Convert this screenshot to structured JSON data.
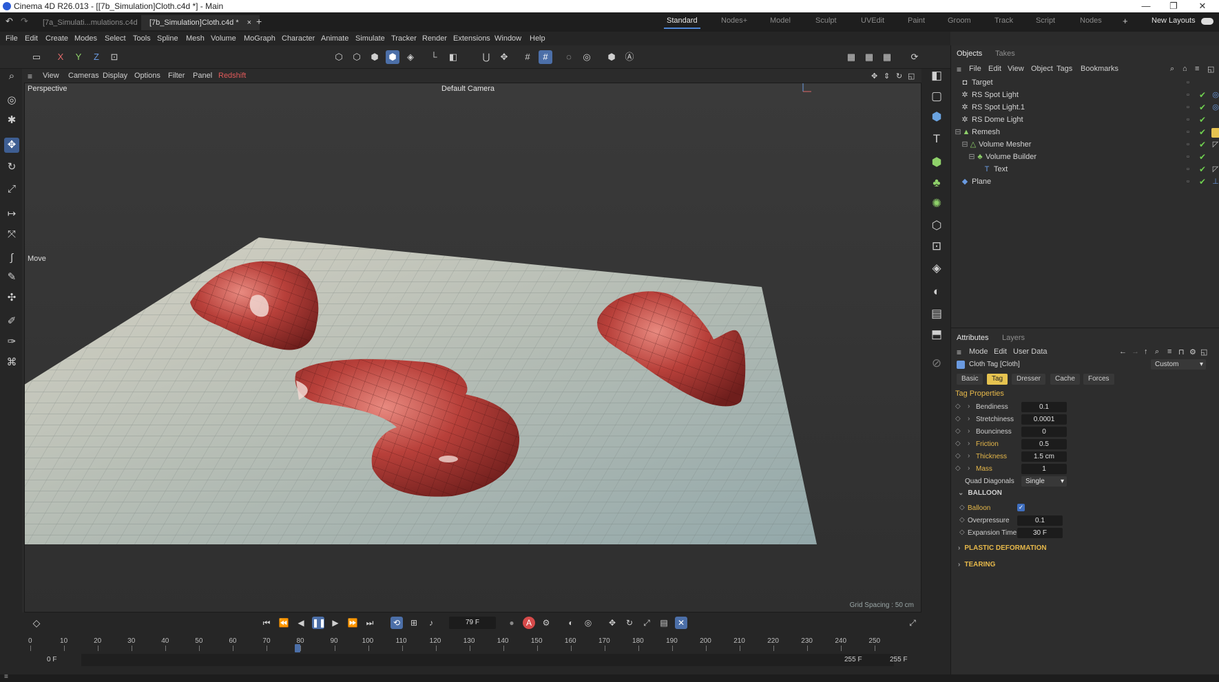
{
  "window": {
    "title": "Cinema 4D R26.013 - [[7b_Simulation]Cloth.c4d *] - Main",
    "controls": [
      "—",
      "❐",
      "✕"
    ]
  },
  "tabs": [
    {
      "label": "[7a_Simulati...mulations.c4d"
    },
    {
      "label": "[7b_Simulation]Cloth.c4d *"
    }
  ],
  "layouts": [
    "Standard",
    "Nodes+",
    "Model",
    "Sculpt",
    "UVEdit",
    "Paint",
    "Groom",
    "Track",
    "Script",
    "Nodes"
  ],
  "new_layouts": "New Layouts",
  "menus": [
    "File",
    "Edit",
    "Create",
    "Modes",
    "Select",
    "Tools",
    "Spline",
    "Mesh",
    "Volume",
    "MoGraph",
    "Character",
    "Animate",
    "Simulate",
    "Tracker",
    "Render",
    "Extensions",
    "Window",
    "Help"
  ],
  "axis_toggles": [
    "X",
    "Y",
    "Z"
  ],
  "viewport": {
    "menu": [
      "View",
      "Cameras",
      "Display",
      "Options",
      "Filter",
      "Panel",
      "Redshift"
    ],
    "label": "Perspective",
    "camera": "Default Camera",
    "tool": "Move",
    "grid_spacing": "Grid Spacing : 50 cm"
  },
  "objects_panel": {
    "tabs": [
      "Objects",
      "Takes"
    ],
    "menu": [
      "File",
      "Edit",
      "View",
      "Object",
      "Tags",
      "Bookmarks"
    ],
    "items": [
      {
        "name": "Target",
        "indent": 0
      },
      {
        "name": "RS Spot Light",
        "indent": 0
      },
      {
        "name": "RS Spot Light.1",
        "indent": 0
      },
      {
        "name": "RS Dome Light",
        "indent": 0
      },
      {
        "name": "Remesh",
        "indent": 0
      },
      {
        "name": "Volume Mesher",
        "indent": 1
      },
      {
        "name": "Volume Builder",
        "indent": 2
      },
      {
        "name": "Text",
        "indent": 3
      },
      {
        "name": "Plane",
        "indent": 0
      }
    ]
  },
  "attributes_panel": {
    "tabs": [
      "Attributes",
      "Layers"
    ],
    "menu": [
      "Mode",
      "Edit",
      "User Data"
    ],
    "object": "Cloth Tag [Cloth]",
    "preset": "Custom",
    "subtabs": [
      "Basic",
      "Tag",
      "Dresser",
      "Cache",
      "Forces"
    ],
    "active_subtab": "Tag",
    "section_title": "Tag Properties",
    "properties": [
      {
        "label": "Bendiness",
        "value": "0.1"
      },
      {
        "label": "Stretchiness",
        "value": "0.0001"
      },
      {
        "label": "Bounciness",
        "value": "0"
      },
      {
        "label": "Friction",
        "value": "0.5"
      },
      {
        "label": "Thickness",
        "value": "1.5 cm"
      },
      {
        "label": "Mass",
        "value": "1"
      }
    ],
    "quad_diagonals": {
      "label": "Quad Diagonals",
      "value": "Single"
    },
    "balloon": {
      "header": "BALLOON",
      "balloon_label": "Balloon",
      "balloon_checked": true,
      "overpressure": {
        "label": "Overpressure",
        "value": "0.1"
      },
      "expansion": {
        "label": "Expansion Time",
        "value": "30 F"
      }
    },
    "sections": [
      "PLASTIC DEFORMATION",
      "TEARING"
    ]
  },
  "timeline": {
    "current_frame": "79 F",
    "ticks": [
      "0",
      "10",
      "20",
      "30",
      "40",
      "50",
      "60",
      "70",
      "80",
      "90",
      "100",
      "110",
      "120",
      "130",
      "140",
      "150",
      "160",
      "170",
      "180",
      "190",
      "200",
      "210",
      "220",
      "230",
      "240",
      "250"
    ],
    "playhead_frame": 79,
    "max_frame": 255,
    "range": {
      "start": "0 F",
      "min": "0 F",
      "max": "255 F",
      "end": "255 F"
    }
  },
  "colors": {
    "accent": "#4f86d6",
    "cloth": "#b8403a",
    "check": "#6fcf4f",
    "tag_active": "#e6c350"
  }
}
